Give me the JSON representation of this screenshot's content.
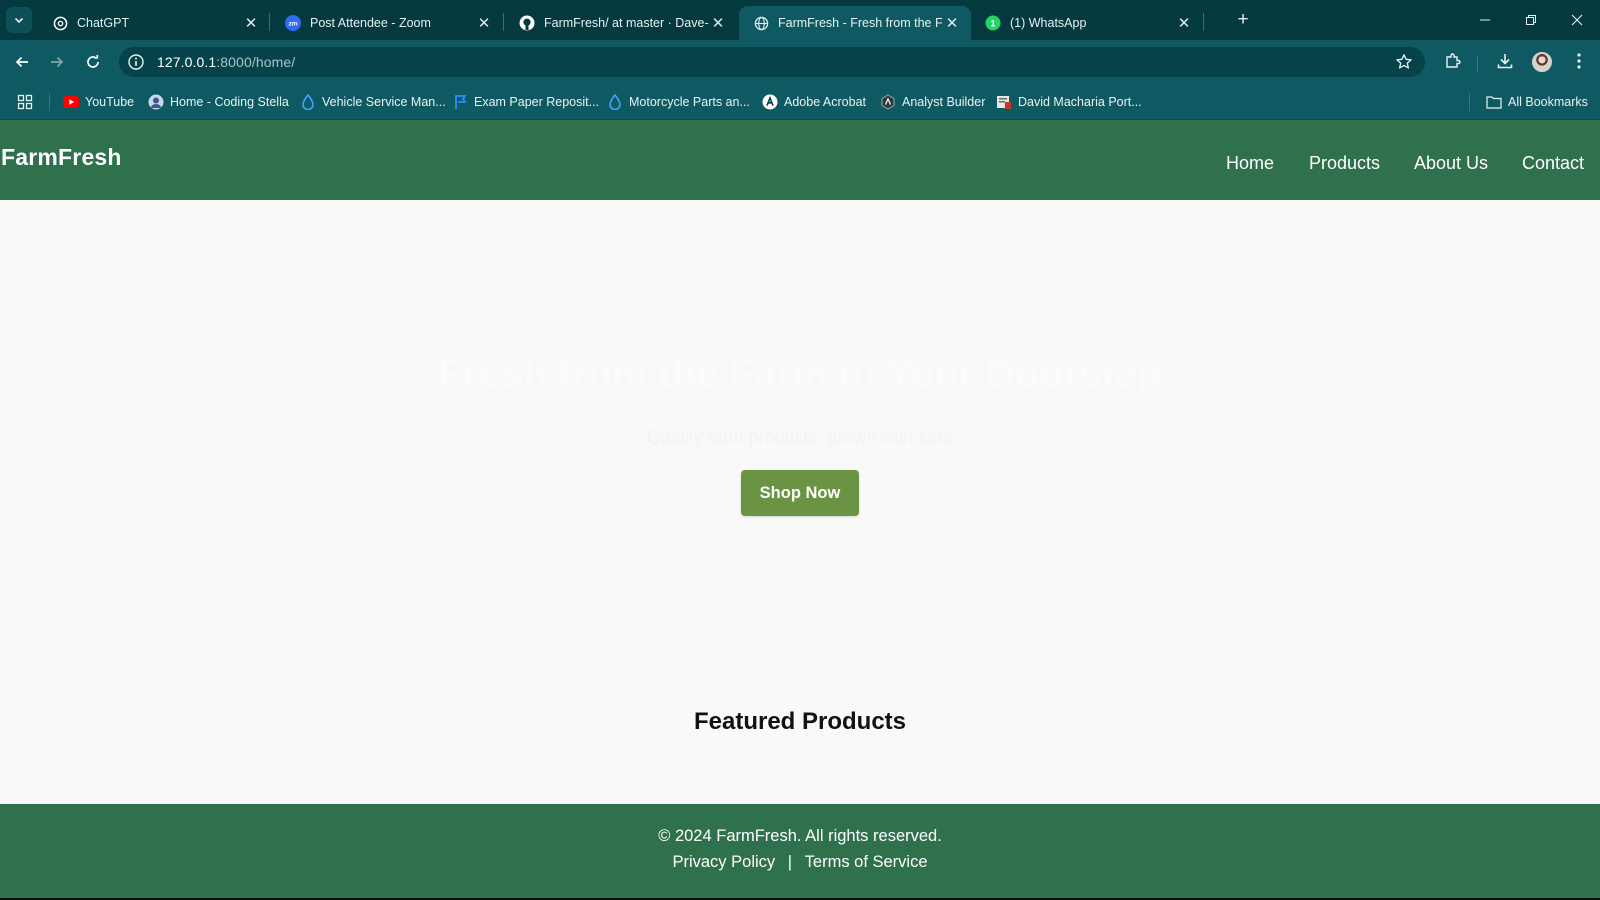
{
  "browser": {
    "tabs": [
      {
        "title": "ChatGPT",
        "icon": "chatgpt-icon",
        "active": false
      },
      {
        "title": "Post Attendee - Zoom",
        "icon": "zoom-icon",
        "active": false
      },
      {
        "title": "FarmFresh/ at master · Dave-nd",
        "icon": "github-icon",
        "active": false
      },
      {
        "title": "FarmFresh - Fresh from the Farm",
        "icon": "globe-icon",
        "active": true
      },
      {
        "title": "(1) WhatsApp",
        "icon": "whatsapp-icon",
        "active": false
      }
    ],
    "address": {
      "host": "127.0.0.1",
      "path": ":8000/home/"
    },
    "bookmarks": [
      {
        "label": "YouTube",
        "icon": "youtube-icon"
      },
      {
        "label": "Home - Coding Stella",
        "icon": "coding-stella-icon"
      },
      {
        "label": "Vehicle Service Man...",
        "icon": "drop-icon"
      },
      {
        "label": "Exam Paper Reposit...",
        "icon": "flag-icon"
      },
      {
        "label": "Motorcycle Parts an...",
        "icon": "drop-icon"
      },
      {
        "label": "Adobe Acrobat",
        "icon": "acrobat-icon"
      },
      {
        "label": "Analyst Builder",
        "icon": "analyst-builder-icon"
      },
      {
        "label": "David Macharia Port...",
        "icon": "portfolio-icon"
      }
    ],
    "all_bookmarks": "All Bookmarks",
    "colors": {
      "tabbar": "#03393f",
      "toolbar": "#0f5a62"
    }
  },
  "site": {
    "brand": "FarmFresh",
    "nav": [
      "Home",
      "Products",
      "About Us",
      "Contact"
    ],
    "hero": {
      "title": "Fresh from the Farm to Your Doorstep",
      "subtitle": "Quality farm products, grown with care",
      "cta": "Shop Now"
    },
    "featured_title": "Featured Products",
    "footer": {
      "copyright": "© 2024 FarmFresh. All rights reserved.",
      "privacy": "Privacy Policy",
      "separator": "|",
      "terms": "Terms of Service"
    },
    "colors": {
      "header": "#2f704d",
      "button": "#6a9444",
      "background": "#f9f9f9"
    }
  }
}
